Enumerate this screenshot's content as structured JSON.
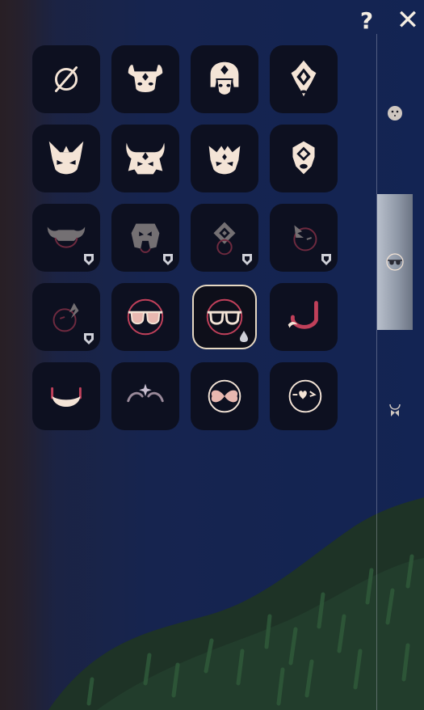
{
  "topbar": {
    "help_label": "?",
    "close_label": "✕"
  },
  "colors": {
    "icon": "#f4e4d6",
    "outline": "#c0405a",
    "cell_bg": "#0d1020",
    "selected_border": "#e6d8c2",
    "tab_active": "#9aa3b1"
  },
  "grid": {
    "items": [
      {
        "icon": "none-icon",
        "locked": false,
        "selected": false
      },
      {
        "icon": "horned-mask-icon",
        "locked": false,
        "selected": false
      },
      {
        "icon": "crowned-mask-icon",
        "locked": false,
        "selected": false
      },
      {
        "icon": "diamond-mask-icon",
        "locked": false,
        "selected": false
      },
      {
        "icon": "fox-mask-icon",
        "locked": false,
        "selected": false
      },
      {
        "icon": "oni-mask-icon",
        "locked": false,
        "selected": false
      },
      {
        "icon": "cat-mask-icon",
        "locked": false,
        "selected": false
      },
      {
        "icon": "shield-mask-icon",
        "locked": false,
        "selected": false
      },
      {
        "icon": "horned-face-icon",
        "locked": true,
        "selected": false
      },
      {
        "icon": "helmet-face-icon",
        "locked": true,
        "selected": false
      },
      {
        "icon": "diamond-face-icon",
        "locked": true,
        "selected": false
      },
      {
        "icon": "feather-face-icon",
        "locked": true,
        "selected": false
      },
      {
        "icon": "spiky-face-icon",
        "locked": true,
        "selected": false
      },
      {
        "icon": "round-glasses-icon",
        "locked": false,
        "selected": false
      },
      {
        "icon": "glasses-icon",
        "locked": false,
        "selected": true
      },
      {
        "icon": "mustache-icon",
        "locked": false,
        "selected": false
      },
      {
        "icon": "beard-icon",
        "locked": false,
        "selected": false
      },
      {
        "icon": "sparkle-brows-icon",
        "locked": false,
        "selected": false
      },
      {
        "icon": "butterfly-face-icon",
        "locked": false,
        "selected": false
      },
      {
        "icon": "heart-wink-icon",
        "locked": false,
        "selected": false
      }
    ]
  },
  "sidebar": {
    "tabs": [
      {
        "icon": "face-icon",
        "active": false
      },
      {
        "icon": "glasses-icon",
        "active": true
      },
      {
        "icon": "neck-icon",
        "active": false
      }
    ]
  }
}
